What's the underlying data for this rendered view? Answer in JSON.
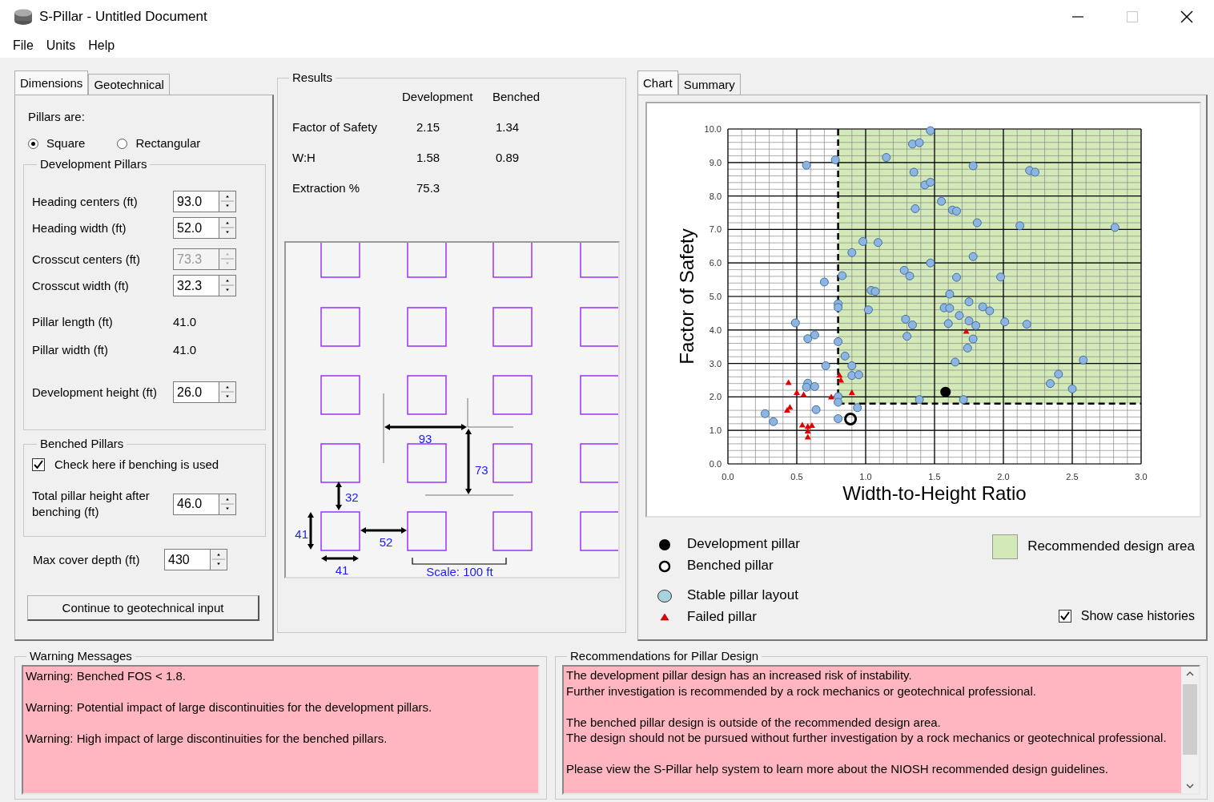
{
  "window": {
    "title": "S-Pillar - Untitled Document",
    "controls": [
      {
        "kind": "minimize",
        "disabled": false
      },
      {
        "kind": "maximize",
        "disabled": true
      },
      {
        "kind": "close",
        "disabled": false
      }
    ]
  },
  "menu": [
    "File",
    "Units",
    "Help"
  ],
  "left_tabs": [
    {
      "label": "Dimensions",
      "selected": true
    },
    {
      "label": "Geotechnical",
      "selected": false
    }
  ],
  "pillars_are": {
    "label": "Pillars are:",
    "options": [
      {
        "label": "Square",
        "selected": true
      },
      {
        "label": "Rectangular",
        "selected": false
      }
    ]
  },
  "development_pillars": {
    "title": "Development Pillars",
    "items": [
      {
        "kind": "spin",
        "label": "Heading centers  (ft)",
        "value": "93.0",
        "disabled": false
      },
      {
        "kind": "spin",
        "label": "Heading width  (ft)",
        "value": "52.0",
        "disabled": false
      },
      {
        "kind": "spin",
        "label": "Crosscut centers (ft)",
        "value": "73.3",
        "disabled": true
      },
      {
        "kind": "spin",
        "label": "Crosscut width  (ft)",
        "value": "32.3",
        "disabled": false
      },
      {
        "kind": "readout",
        "label": "Pillar length  (ft)",
        "value": "41.0"
      },
      {
        "kind": "readout",
        "label": "Pillar width  (ft)",
        "value": "41.0"
      },
      {
        "kind": "spin",
        "label": "Development height (ft)",
        "value": "26.0",
        "disabled": false
      }
    ]
  },
  "benched_pillars": {
    "title": "Benched Pillars",
    "checkbox": {
      "label": "Check here if benching is used",
      "checked": true
    },
    "field": {
      "label": "Total pillar height after benching (ft)",
      "value": "46.0",
      "disabled": false
    }
  },
  "max_cover": {
    "label": "Max cover depth (ft)",
    "value": "430",
    "disabled": false
  },
  "continue_button": "Continue to geotechnical input",
  "results": {
    "title": "Results",
    "columns": [
      "Development",
      "Benched"
    ],
    "rows": [
      {
        "label": "Factor of Safety",
        "values": [
          "2.15",
          "1.34"
        ]
      },
      {
        "label": "W:H",
        "values": [
          "1.58",
          "0.89"
        ]
      },
      {
        "label": "Extraction %",
        "values": [
          "75.3"
        ]
      }
    ]
  },
  "layout_dimensions": [
    {
      "kind": "heading_centers",
      "text": "93"
    },
    {
      "kind": "crosscut_centers",
      "text": "73"
    },
    {
      "kind": "crosscut_width",
      "text": "32"
    },
    {
      "kind": "pillar_length",
      "text": "41"
    },
    {
      "kind": "heading_width",
      "text": "52"
    },
    {
      "kind": "pillar_width",
      "text": "41"
    },
    {
      "kind": "scale",
      "text": "Scale: 100 ft"
    }
  ],
  "right_tabs": [
    {
      "label": "Chart",
      "selected": true
    },
    {
      "label": "Summary",
      "selected": false
    }
  ],
  "chart": {
    "chart_data": {
      "type": "scatter",
      "xlabel": "Width-to-Height Ratio",
      "ylabel": "Factor of Safety",
      "xlim": [
        0,
        3
      ],
      "ylim": [
        0,
        10
      ],
      "grid": true,
      "bands": [
        {
          "axis": "x",
          "from": 0.8,
          "to": 3,
          "color": "#d3e9b8",
          "label": "Recommended design area"
        }
      ],
      "ref_lines": [
        {
          "axis": "x",
          "value": 0.8
        },
        {
          "axis": "y",
          "value": 1.8
        }
      ],
      "xticks": [
        {
          "value": 0,
          "label": "0.0"
        },
        {
          "value": 0.5,
          "label": "0.5"
        },
        {
          "value": 1,
          "label": "1.0"
        },
        {
          "value": 1.5,
          "label": "1.5"
        },
        {
          "value": 2,
          "label": "2.0"
        },
        {
          "value": 2.5,
          "label": "2.5"
        },
        {
          "value": 3,
          "label": "3.0"
        }
      ],
      "yticks": [
        {
          "value": 0,
          "label": "0.0"
        },
        {
          "value": 1,
          "label": "1.0"
        },
        {
          "value": 2,
          "label": "2.0"
        },
        {
          "value": 3,
          "label": "3.0"
        },
        {
          "value": 4,
          "label": "4.0"
        },
        {
          "value": 5,
          "label": "5.0"
        },
        {
          "value": 6,
          "label": "6.0"
        },
        {
          "value": 7,
          "label": "7.0"
        },
        {
          "value": 8,
          "label": "8.0"
        },
        {
          "value": 9,
          "label": "9.0"
        },
        {
          "value": 10,
          "label": "10.0"
        }
      ],
      "x": [
        1.58,
        0.89,
        1.47,
        1.34,
        1.39,
        1.15,
        0.57,
        0.78,
        1.78,
        2.19,
        2.23,
        1.35,
        1.43,
        1.47,
        1.55,
        1.36,
        1.63,
        1.66,
        1.81,
        2.12,
        2.81,
        0.98,
        1.09,
        0.9,
        1.78,
        1.47,
        1.28,
        1.32,
        0.83,
        1.66,
        1.98,
        0.7,
        1.04,
        1.07,
        1.61,
        0.8,
        0.8,
        1.02,
        1.57,
        1.61,
        1.75,
        1.85,
        1.9,
        1.68,
        1.75,
        1.8,
        1.29,
        1.34,
        1.6,
        2.01,
        2.17,
        0.49,
        0.58,
        0.63,
        1.3,
        1.78,
        0.8,
        1.74,
        0.85,
        1.65,
        2.58,
        0.71,
        0.9,
        0.9,
        0.95,
        2.4,
        2.34,
        2.5,
        0.58,
        0.57,
        0.63,
        0.8,
        0.8,
        1.39,
        1.71,
        0.94,
        0.64,
        0.27,
        0.33,
        0.8,
        0.44,
        0.5,
        0.55,
        0.75,
        0.81,
        0.82,
        0.9,
        1.73,
        0.45,
        0.43,
        0.54,
        0.58,
        0.61,
        0.58,
        0.58
      ],
      "series": [
        {
          "name": "Development pillar",
          "color": "#000000",
          "values": [
            2.15,
            null,
            null,
            null,
            null,
            null,
            null,
            null,
            null,
            null,
            null,
            null,
            null,
            null,
            null,
            null,
            null,
            null,
            null,
            null,
            null,
            null,
            null,
            null,
            null,
            null,
            null,
            null,
            null,
            null,
            null,
            null,
            null,
            null,
            null,
            null,
            null,
            null,
            null,
            null,
            null,
            null,
            null,
            null,
            null,
            null,
            null,
            null,
            null,
            null,
            null,
            null,
            null,
            null,
            null,
            null,
            null,
            null,
            null,
            null,
            null,
            null,
            null,
            null,
            null,
            null,
            null,
            null,
            null,
            null,
            null,
            null,
            null,
            null,
            null,
            null,
            null,
            null,
            null,
            null,
            null,
            null,
            null,
            null,
            null,
            null,
            null,
            null,
            null,
            null,
            null,
            null,
            null,
            null,
            null
          ]
        },
        {
          "name": "Benched pillar",
          "color": "#000000",
          "values": [
            null,
            1.34,
            null,
            null,
            null,
            null,
            null,
            null,
            null,
            null,
            null,
            null,
            null,
            null,
            null,
            null,
            null,
            null,
            null,
            null,
            null,
            null,
            null,
            null,
            null,
            null,
            null,
            null,
            null,
            null,
            null,
            null,
            null,
            null,
            null,
            null,
            null,
            null,
            null,
            null,
            null,
            null,
            null,
            null,
            null,
            null,
            null,
            null,
            null,
            null,
            null,
            null,
            null,
            null,
            null,
            null,
            null,
            null,
            null,
            null,
            null,
            null,
            null,
            null,
            null,
            null,
            null,
            null,
            null,
            null,
            null,
            null,
            null,
            null,
            null,
            null,
            null,
            null,
            null,
            null,
            null,
            null,
            null,
            null,
            null,
            null,
            null,
            null,
            null,
            null,
            null,
            null,
            null,
            null,
            null
          ]
        },
        {
          "name": "Stable pillar layout",
          "color": "#8db4e2",
          "values": [
            null,
            null,
            9.95,
            9.55,
            9.59,
            9.15,
            8.92,
            9.08,
            8.9,
            8.76,
            8.71,
            8.71,
            8.33,
            8.41,
            7.84,
            7.62,
            7.58,
            7.55,
            7.2,
            7.11,
            7.06,
            6.64,
            6.61,
            6.31,
            6.19,
            6.0,
            5.78,
            5.61,
            5.62,
            5.57,
            5.58,
            5.43,
            5.18,
            5.15,
            5.07,
            4.78,
            4.67,
            4.6,
            4.66,
            4.65,
            4.84,
            4.69,
            4.57,
            4.43,
            4.27,
            4.13,
            4.32,
            4.15,
            4.19,
            4.24,
            4.17,
            4.21,
            3.74,
            3.85,
            3.81,
            3.73,
            3.65,
            3.46,
            3.22,
            3.04,
            3.1,
            2.93,
            2.93,
            2.64,
            2.66,
            2.68,
            2.4,
            2.24,
            2.41,
            2.29,
            2.31,
            2.01,
            1.84,
            1.92,
            1.92,
            1.68,
            1.62,
            1.5,
            1.26,
            1.35,
            null,
            null,
            null,
            null,
            null,
            null,
            null,
            null,
            null,
            null,
            null,
            null,
            null,
            null,
            null
          ]
        },
        {
          "name": "Failed pillar",
          "color": "#e00000",
          "values": [
            null,
            null,
            null,
            null,
            null,
            null,
            null,
            null,
            null,
            null,
            null,
            null,
            null,
            null,
            null,
            null,
            null,
            null,
            null,
            null,
            null,
            null,
            null,
            null,
            null,
            null,
            null,
            null,
            null,
            null,
            null,
            null,
            null,
            null,
            null,
            null,
            null,
            null,
            null,
            null,
            null,
            null,
            null,
            null,
            null,
            null,
            null,
            null,
            null,
            null,
            null,
            null,
            null,
            null,
            null,
            null,
            null,
            null,
            null,
            null,
            null,
            null,
            null,
            null,
            null,
            null,
            null,
            null,
            null,
            null,
            null,
            null,
            null,
            null,
            null,
            null,
            null,
            null,
            null,
            null,
            2.43,
            2.13,
            2.07,
            2.0,
            2.65,
            2.5,
            2.13,
            3.96,
            1.69,
            1.6,
            1.16,
            1.12,
            1.15,
            0.98,
            0.8
          ]
        }
      ]
    }
  },
  "show_case_histories": {
    "label": "Show case histories",
    "checked": true
  },
  "warnings": {
    "title": "Warning Messages",
    "messages": [
      "Warning: Benched FOS < 1.8.",
      "Warning: Potential impact of large discontinuities for the development pillars.",
      "Warning: High impact of large discontinuities for the benched pillars."
    ]
  },
  "recommendations": {
    "title": "Recommendations for Pillar Design",
    "paragraphs": [
      [
        "The development pillar design has an increased risk of instability.",
        "Further investigation is recommended by a rock mechanics or geotechnical professional."
      ],
      [
        "The benched pillar design is outside of the recommended design area.",
        "The design should not be pursued without further investigation by a rock mechanics or geotechnical professional."
      ],
      [
        "Please view the S-Pillar help system to learn more about the NIOSH recommended design guidelines."
      ]
    ]
  }
}
